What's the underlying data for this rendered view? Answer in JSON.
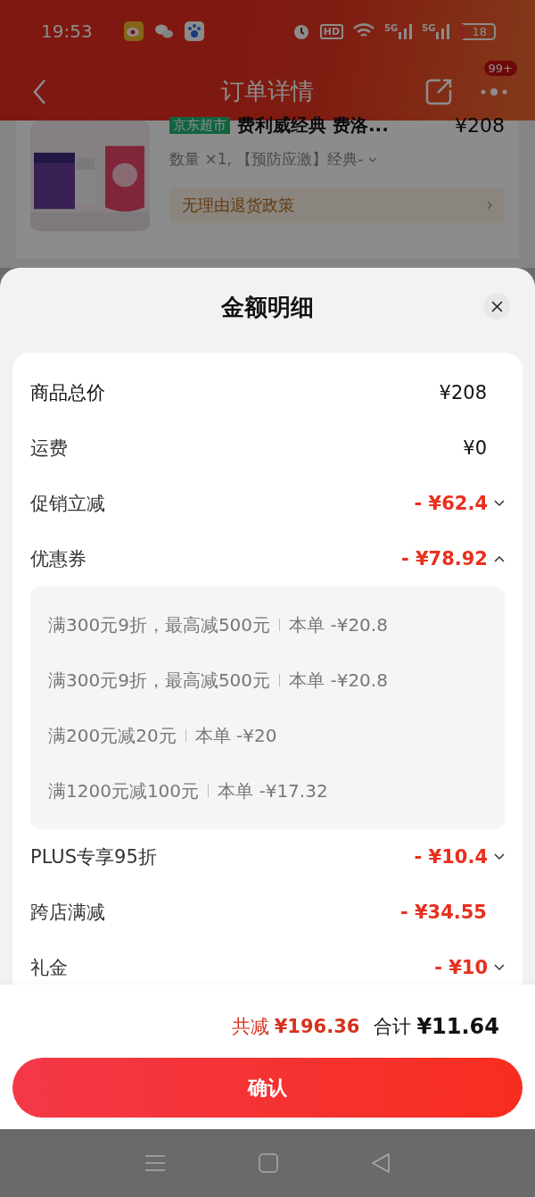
{
  "status_bar": {
    "time": "19:53",
    "hd": "HD",
    "signals": [
      "5G",
      "5G"
    ],
    "battery": "18"
  },
  "nav": {
    "title": "订单详情",
    "badge": "99+"
  },
  "product": {
    "tag": "京东超市",
    "title": "费利威经典 费洛...",
    "price": "¥208",
    "spec": "数量 ×1, 【预防应激】经典-",
    "policy": "无理由退货政策"
  },
  "sheet": {
    "title": "金额明细"
  },
  "rows": [
    {
      "label": "商品总价",
      "amount": "¥208",
      "kind": "plain"
    },
    {
      "label": "运费",
      "amount": "¥0",
      "kind": "plain"
    },
    {
      "label": "促销立减",
      "amount": "- ¥62.4",
      "kind": "discount",
      "expanded": false
    },
    {
      "label": "优惠券",
      "amount": "- ¥78.92",
      "kind": "discount",
      "expanded": true,
      "details": [
        {
          "rule": "满300元9折，最高减500元",
          "amount": "本单 -¥20.8"
        },
        {
          "rule": "满300元9折，最高减500元",
          "amount": "本单 -¥20.8"
        },
        {
          "rule": "满200元减20元",
          "amount": "本单 -¥20"
        },
        {
          "rule": "满1200元减100元",
          "amount": "本单 -¥17.32"
        }
      ]
    },
    {
      "label": "PLUS专享95折",
      "amount": "- ¥10.4",
      "kind": "discount",
      "expanded": false
    },
    {
      "label": "跨店满减",
      "amount": "- ¥34.55",
      "kind": "discount"
    },
    {
      "label": "礼金",
      "amount": "- ¥10",
      "kind": "discount",
      "expanded": false
    }
  ],
  "summary": {
    "saved_label": "共减",
    "saved": "¥196.36",
    "total_label": "合计",
    "total": "¥11.64"
  },
  "confirm_button": "确认"
}
